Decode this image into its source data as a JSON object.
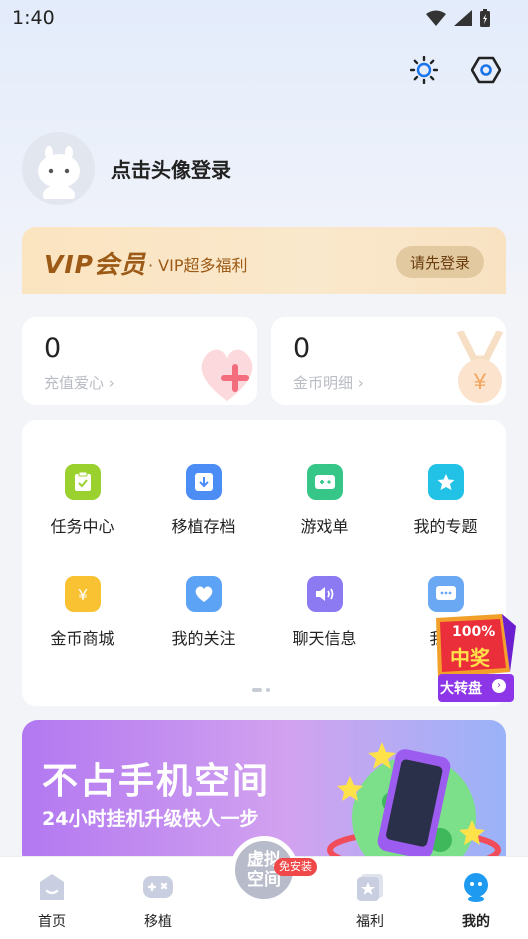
{
  "status": {
    "time": "1:40"
  },
  "profile": {
    "login_text": "点击头像登录"
  },
  "vip": {
    "logo": "VIP会员",
    "subtitle": "· VIP超多福利",
    "button": "请先登录"
  },
  "stats": [
    {
      "value": "0",
      "label": "充值爱心 ›"
    },
    {
      "value": "0",
      "label": "金币明细 ›"
    }
  ],
  "grid": [
    {
      "label": "任务中心",
      "icon": "clipboard-icon",
      "color": "#9bd12e"
    },
    {
      "label": "移植存档",
      "icon": "archive-icon",
      "color": "#4c8df5"
    },
    {
      "label": "游戏单",
      "icon": "gamepad-icon",
      "color": "#36c788"
    },
    {
      "label": "我的专题",
      "icon": "star-icon",
      "color": "#22c1e6"
    },
    {
      "label": "金币商城",
      "icon": "yen-icon",
      "color": "#f8c233"
    },
    {
      "label": "我的关注",
      "icon": "heart-icon",
      "color": "#5da3f5"
    },
    {
      "label": "聊天信息",
      "icon": "speaker-icon",
      "color": "#8b7af2"
    },
    {
      "label": "我的",
      "icon": "chat-icon",
      "color": "#6aa8f3"
    }
  ],
  "lottery": {
    "badge": "100%",
    "title": "中奖",
    "button": "大转盘"
  },
  "banner": {
    "title": "不占手机空间",
    "subtitle": "24小时挂机升级快人一步"
  },
  "nav": {
    "items": [
      {
        "label": "首页"
      },
      {
        "label": "移植"
      },
      {
        "label": "福利"
      },
      {
        "label": "我的"
      }
    ],
    "center_label": "虚拟空间",
    "center_badge": "免安装"
  }
}
